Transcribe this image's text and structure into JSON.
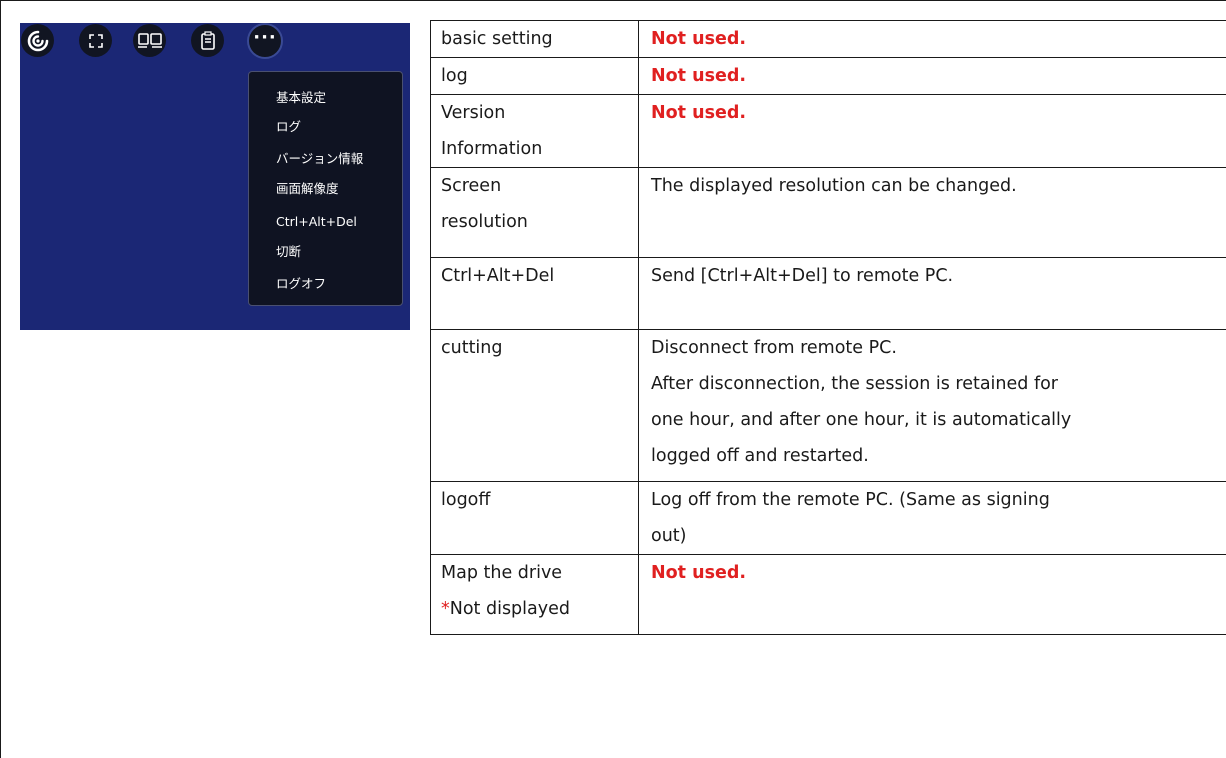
{
  "toolbar": {
    "icons": [
      "session-icon",
      "fullscreen-icon",
      "display-icon",
      "clipboard-icon",
      "more-icon"
    ],
    "more_label": "···"
  },
  "menu": {
    "items": [
      {
        "label": "基本設定"
      },
      {
        "label": "ログ"
      },
      {
        "label": "バージョン情報"
      },
      {
        "label": "画面解像度"
      },
      {
        "label": "Ctrl+Alt+Del"
      },
      {
        "label": "切断"
      },
      {
        "label": "ログオフ"
      }
    ]
  },
  "table": {
    "rows": [
      {
        "name": "basic setting",
        "desc": "Not used.",
        "not_used": true
      },
      {
        "name": "log",
        "desc": "Not used.",
        "not_used": true
      },
      {
        "name_lines": [
          "Version",
          "Information"
        ],
        "desc": "Not used.",
        "not_used": true
      },
      {
        "name_lines": [
          "Screen",
          "resolution"
        ],
        "desc": "The displayed resolution can be changed."
      },
      {
        "name": "Ctrl+Alt+Del",
        "desc": "Send [Ctrl+Alt+Del] to remote PC."
      },
      {
        "name": "cutting",
        "desc_lines": [
          "Disconnect from remote PC.",
          "After disconnection, the session is retained for",
          "one hour, and after one hour, it is automatically",
          "logged off and restarted."
        ]
      },
      {
        "name": "logoff",
        "desc_lines": [
          "Log off from the remote PC. (Same as signing",
          "out)"
        ]
      },
      {
        "name": "Map the drive",
        "note_star": "*",
        "note_text": "Not displayed",
        "desc": "Not used.",
        "not_used": true
      }
    ]
  },
  "colors": {
    "screen_bg": "#1b2775",
    "button_bg": "#111522",
    "menu_bg": "#0f1322",
    "not_used": "#e02020"
  }
}
